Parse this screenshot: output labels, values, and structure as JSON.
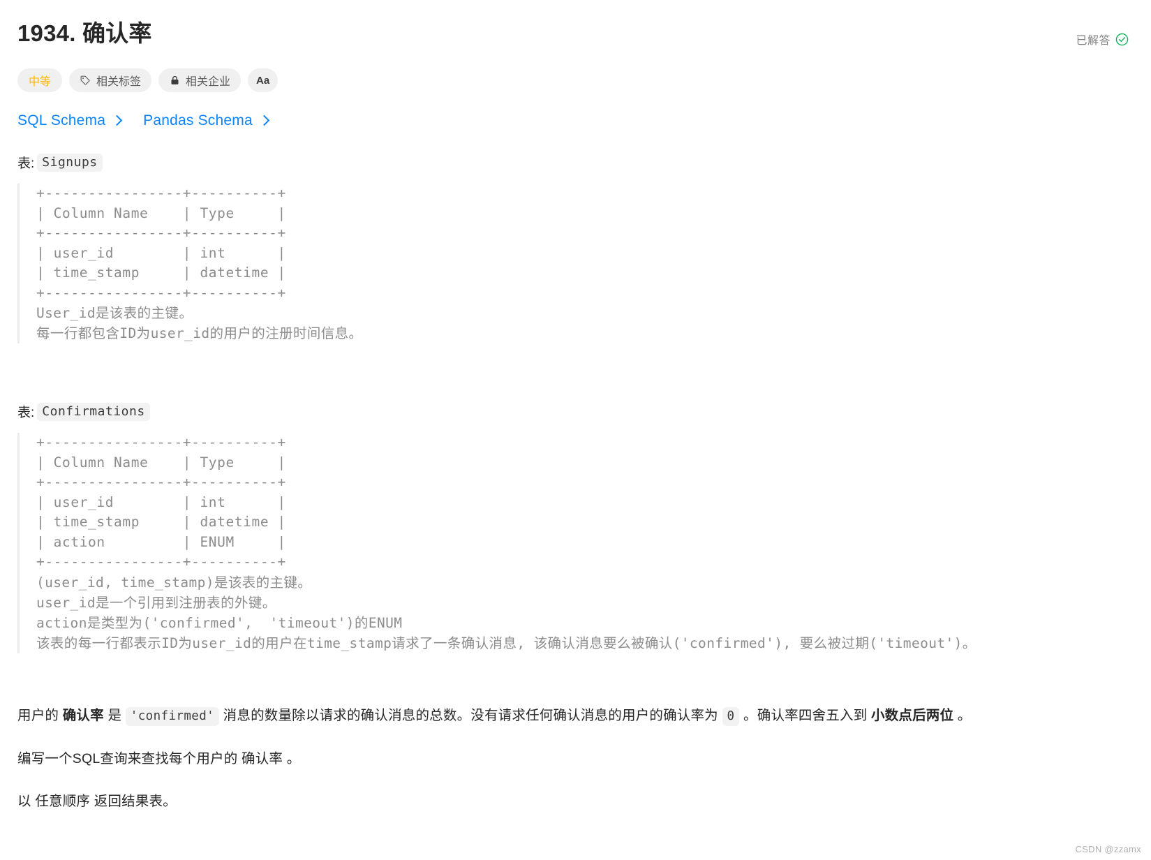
{
  "header": {
    "title": "1934. 确认率",
    "solved_label": "已解答",
    "solved_icon": "check-circle-icon",
    "solved_color": "#00af54"
  },
  "pills": [
    {
      "label": "中等",
      "icon": null,
      "color": "#ffb800",
      "name": "difficulty-badge"
    },
    {
      "label": "相关标签",
      "icon": "tag-icon",
      "color": "#5c5c5c",
      "name": "related-tags-button"
    },
    {
      "label": "相关企业",
      "icon": "lock-icon",
      "color": "#5c5c5c",
      "name": "related-companies-button"
    },
    {
      "label": "Aa",
      "icon": null,
      "color": "#3c3c3c",
      "name": "font-size-button"
    }
  ],
  "schema_links": [
    {
      "label": "SQL Schema",
      "chevron": "chevron-right-icon"
    },
    {
      "label": "Pandas Schema",
      "chevron": "chevron-right-icon"
    }
  ],
  "tables": [
    {
      "caption_prefix": "表:",
      "name": "Signups",
      "ascii": "+----------------+----------+\n| Column Name    | Type     |\n+----------------+----------+\n| user_id        | int      |\n| time_stamp     | datetime |\n+----------------+----------+",
      "notes": "User_id是该表的主键。\n每一行都包含ID为user_id的用户的注册时间信息。"
    },
    {
      "caption_prefix": "表:",
      "name": "Confirmations",
      "ascii": "+----------------+----------+\n| Column Name    | Type     |\n+----------------+----------+\n| user_id        | int      |\n| time_stamp     | datetime |\n| action         | ENUM     |\n+----------------+----------+",
      "notes": "(user_id, time_stamp)是该表的主键。\nuser_id是一个引用到注册表的外键。\naction是类型为('confirmed',  'timeout')的ENUM\n该表的每一行都表示ID为user_id的用户在time_stamp请求了一条确认消息, 该确认消息要么被确认('confirmed'), 要么被过期('timeout')。"
    }
  ],
  "description": {
    "p1": {
      "s1": "用户的 ",
      "b1": "确认率",
      "s2": " 是 ",
      "code1": "'confirmed'",
      "s3": " 消息的数量除以请求的确认消息的总数。没有请求任何确认消息的用户的确认率为 ",
      "code2": "0",
      "s4": " 。确认率四舍五入到 ",
      "b2": "小数点后两位",
      "s5": " 。"
    },
    "p2": "编写一个SQL查询来查找每个用户的 确认率 。",
    "p3": "以 任意顺序 返回结果表。"
  },
  "watermark": "CSDN @zzamx"
}
